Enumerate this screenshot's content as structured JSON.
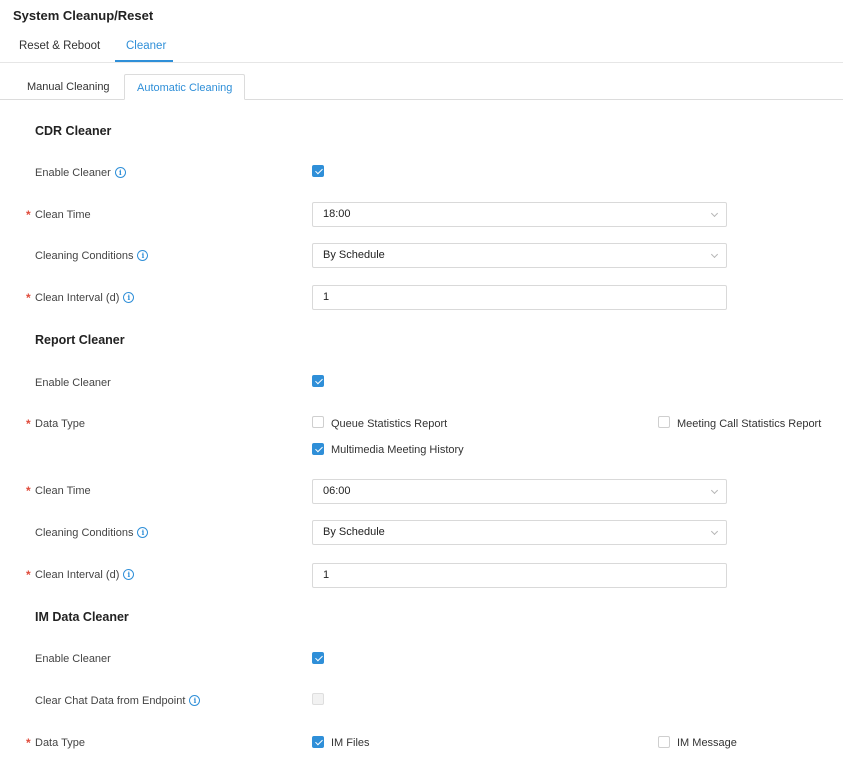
{
  "page": {
    "title": "System Cleanup/Reset"
  },
  "tabs": [
    {
      "label": "Reset & Reboot",
      "active": false
    },
    {
      "label": "Cleaner",
      "active": true
    }
  ],
  "subtabs": [
    {
      "label": "Manual Cleaning",
      "active": false
    },
    {
      "label": "Automatic Cleaning",
      "active": true
    }
  ],
  "info_glyph": "i",
  "required_mark": "*",
  "cdr": {
    "title": "CDR Cleaner",
    "enable_label": "Enable Cleaner",
    "enable_checked": true,
    "clean_time_label": "Clean Time",
    "clean_time_value": "18:00",
    "conditions_label": "Cleaning Conditions",
    "conditions_value": "By Schedule",
    "interval_label": "Clean Interval (d)",
    "interval_value": "1"
  },
  "report": {
    "title": "Report Cleaner",
    "enable_label": "Enable Cleaner",
    "enable_checked": true,
    "data_type_label": "Data Type",
    "data_types": [
      {
        "label": "Queue Statistics Report",
        "checked": false
      },
      {
        "label": "Meeting Call Statistics Report",
        "checked": false
      },
      {
        "label": "Multimedia Meeting History",
        "checked": true
      }
    ],
    "clean_time_label": "Clean Time",
    "clean_time_value": "06:00",
    "conditions_label": "Cleaning Conditions",
    "conditions_value": "By Schedule",
    "interval_label": "Clean Interval (d)",
    "interval_value": "1"
  },
  "im": {
    "title": "IM Data Cleaner",
    "enable_label": "Enable Cleaner",
    "enable_checked": true,
    "clear_chat_label": "Clear Chat Data from Endpoint",
    "clear_chat_checked": false,
    "clear_chat_disabled": true,
    "data_type_label": "Data Type",
    "data_types": [
      {
        "label": "IM Files",
        "checked": true
      },
      {
        "label": "IM Message",
        "checked": false
      }
    ]
  },
  "colors": {
    "accent": "#2f8fd8",
    "required": "#e04c3c"
  }
}
